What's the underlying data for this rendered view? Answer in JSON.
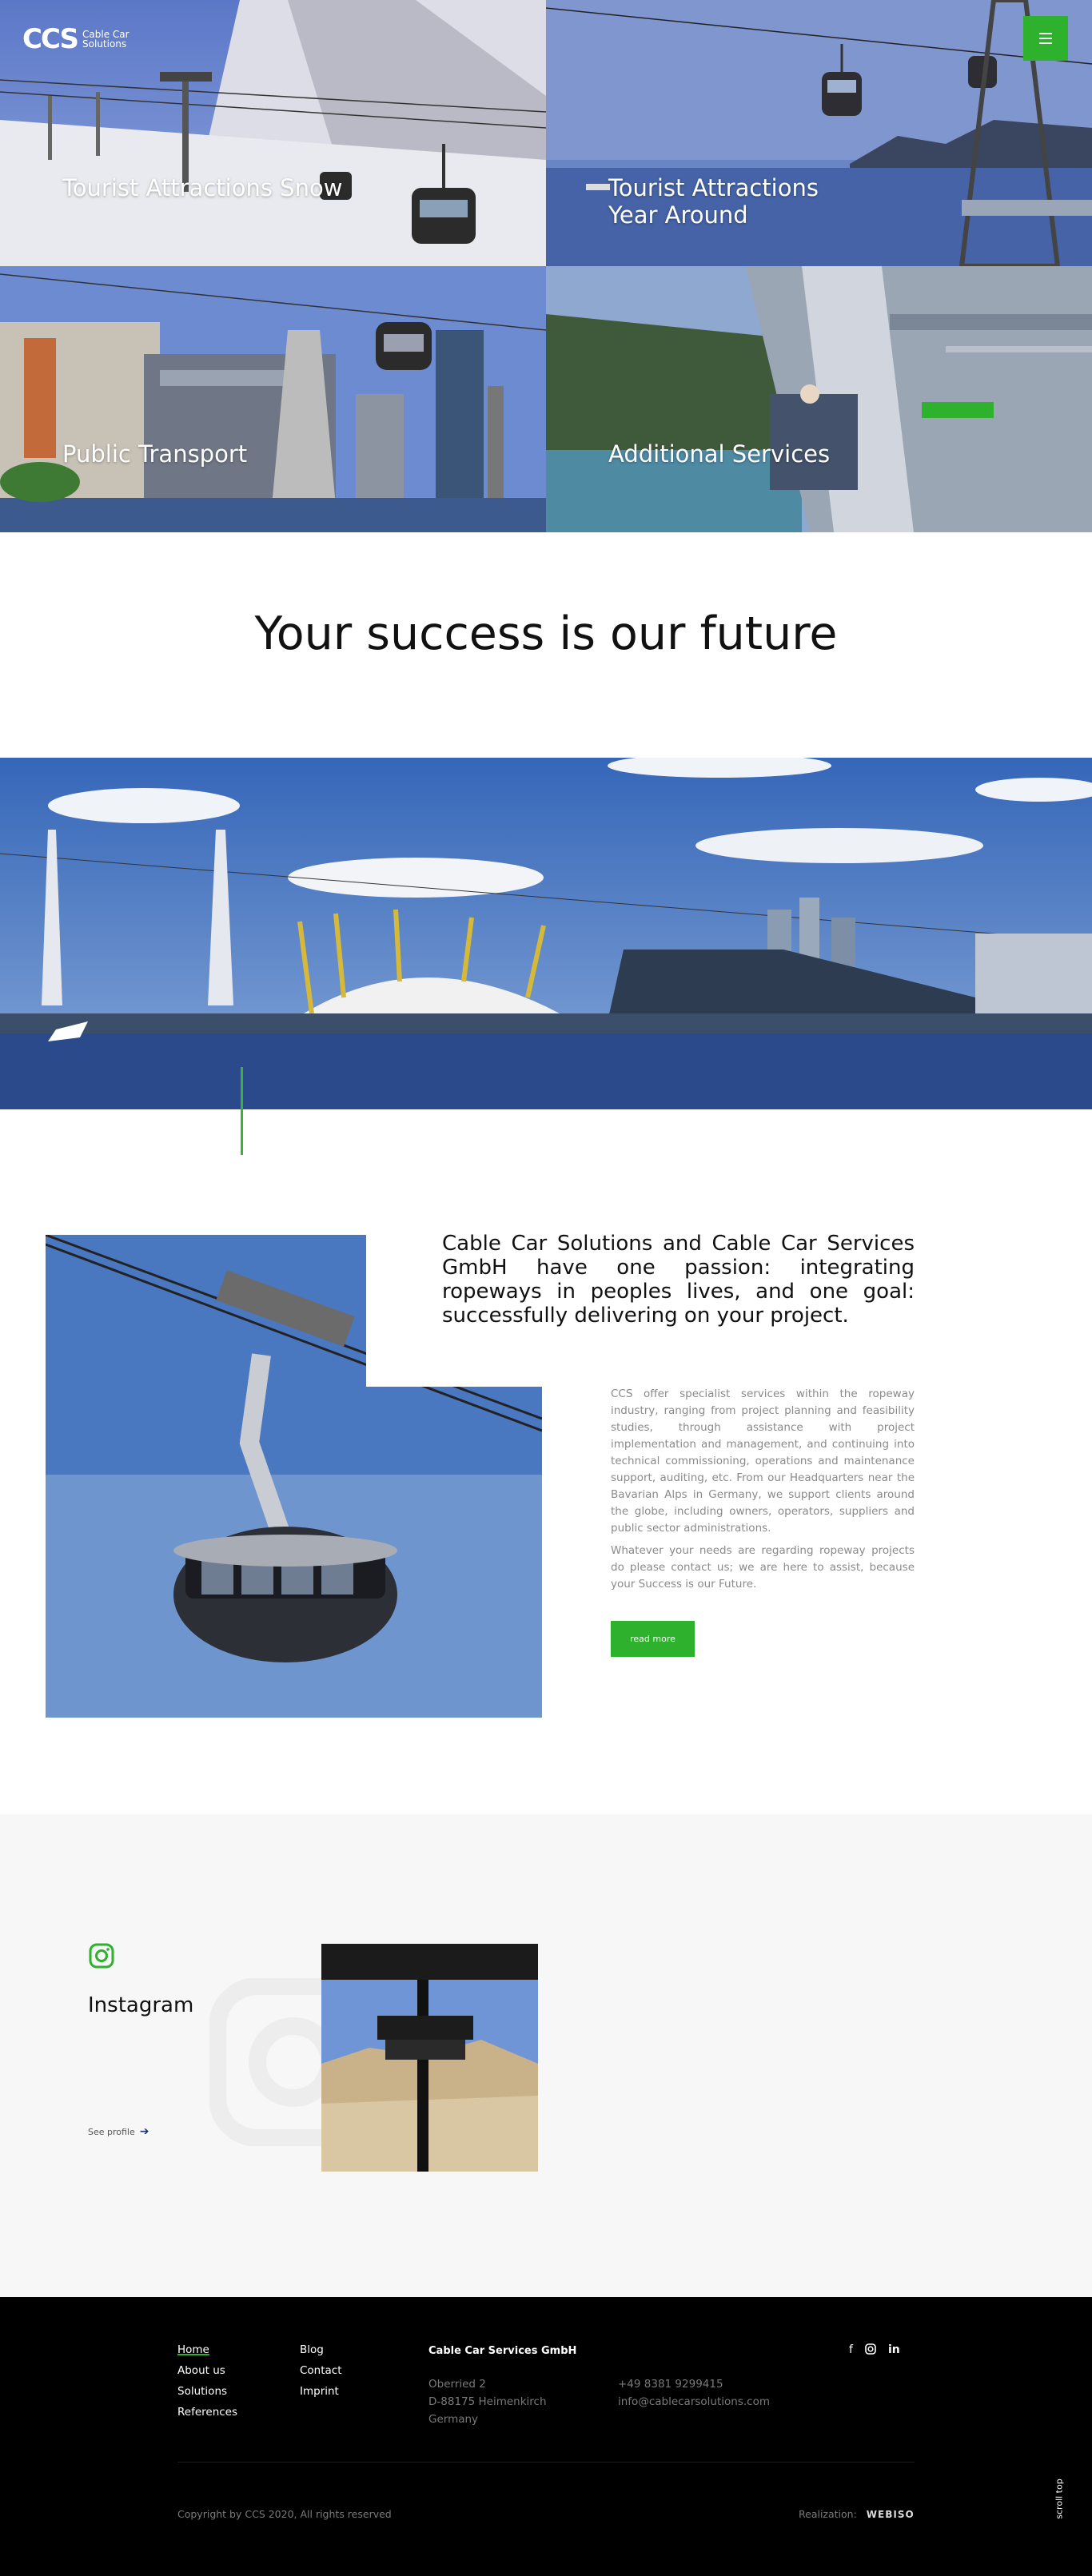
{
  "brand": {
    "logo_mark": "CCS",
    "logo_text": "Cable Car Solutions",
    "accent": "#2eb22e"
  },
  "header": {
    "menu_icon": "hamburger-icon"
  },
  "tiles": [
    {
      "label": "Tourist Attractions Snow"
    },
    {
      "label": "Tourist Attractions\nYear Around"
    },
    {
      "label": "Public Transport"
    },
    {
      "label": "Additional Services"
    }
  ],
  "headline": "Your success is our future",
  "intro": {
    "lead": "Cable Car Solutions and Cable Car Services GmbH have one passion: integrating ropeways in peoples lives, and one goal: successfully delivering on your project.",
    "body1": "CCS offer specialist services within the ropeway industry, ranging from project planning and feasibility studies, through assistance with project implementation and management, and continuing into technical commissioning, operations and maintenance support, auditing, etc. From our Headquarters near the Bavarian Alps in Germany, we support clients around the globe, including owners, operators, suppliers and public sector administrations.",
    "body2": "Whatever your needs are regarding ropeway projects do please contact us; we are here to assist, because your Success is our Future.",
    "button": "read more"
  },
  "instagram": {
    "title": "Instagram",
    "link": "See profile",
    "icon": "instagram-icon"
  },
  "footer": {
    "nav1": [
      "Home",
      "About us",
      "Solutions",
      "References"
    ],
    "nav2": [
      "Blog",
      "Contact",
      "Imprint"
    ],
    "company": "Cable Car Services GmbH",
    "address": [
      "Oberried 2",
      "D-88175 Heimenkirch",
      "Germany"
    ],
    "phone": "+49 8381 9299415",
    "email": "info@cablecarsolutions.com",
    "social": [
      "facebook-icon",
      "instagram-icon",
      "linkedin-icon"
    ],
    "copyright": "Copyright by CCS 2020, All rights reserved",
    "realization_label": "Realization:",
    "realization_brand": "WEBISO",
    "scroll_top": "scroll top"
  }
}
